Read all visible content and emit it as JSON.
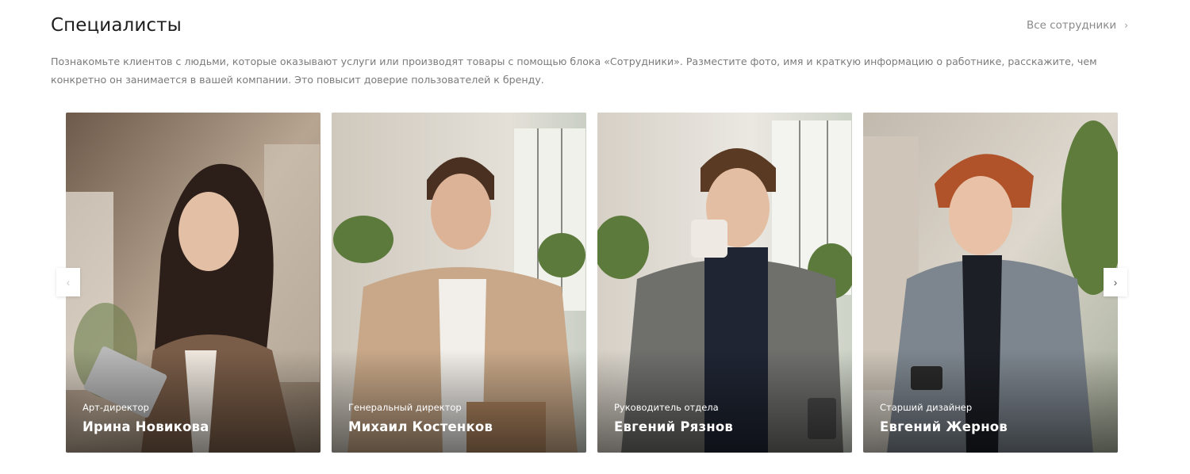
{
  "header": {
    "title": "Специалисты",
    "all_link_label": "Все сотрудники",
    "all_link_icon": "chevron-right-icon"
  },
  "intro": {
    "text": "Познакомьте клиентов с людьми, которые оказывают услуги или производят товары с помощью блока «Сотрудники». Разместите фото, имя и краткую информацию о работнике, расскажите, чем конкретно он занимается в вашей компании. Это повысит доверие пользователей к бренду."
  },
  "carousel": {
    "prev_icon": "chevron-left-icon",
    "next_icon": "chevron-right-icon",
    "prev_label": "‹",
    "next_label": "›",
    "cards": [
      {
        "role": "Арт-директор",
        "name": "Ирина Новикова"
      },
      {
        "role": "Генеральный директор",
        "name": "Михаил Костенков"
      },
      {
        "role": "Руководитель отдела",
        "name": "Евгений Рязнов"
      },
      {
        "role": "Старший дизайнер",
        "name": "Евгений Жернов"
      }
    ]
  }
}
